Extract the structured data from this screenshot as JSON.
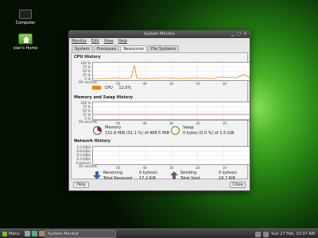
{
  "desktop": {
    "icons": [
      {
        "label": "Computer"
      },
      {
        "label": "slan's Home"
      }
    ]
  },
  "window": {
    "title": "System Monitor",
    "menu": [
      "Monitor",
      "Edit",
      "View",
      "Help"
    ],
    "tabs": [
      "System",
      "Processes",
      "Resources",
      "File Systems"
    ],
    "active_tab": "Resources",
    "cpu": {
      "heading": "CPU History",
      "ticks": [
        "100 %",
        "75 %",
        "50 %",
        "25 %",
        "0 %",
        "60 seconds",
        "50",
        "40",
        "30",
        "20",
        "10"
      ],
      "legend_label": "CPU",
      "legend_value": "11.0%",
      "color": "#e8881c"
    },
    "memory": {
      "heading": "Memory and Swap History",
      "ticks": [
        "100 %",
        "75 %",
        "50 %",
        "25 %",
        "0 %",
        "60 seconds",
        "50",
        "40",
        "30",
        "20",
        "10"
      ],
      "memory_label": "Memory",
      "memory_value": "151.8 MiB (31.1 %) of 488.5 MiB",
      "swap_label": "Swap",
      "swap_value": "0 bytes (0.0 %) of 1.5 GiB",
      "memory_color": "#8b1a5c",
      "swap_color": "#4e9a06"
    },
    "network": {
      "heading": "Network History",
      "ticks": [
        "1.0 KiB/s",
        "0.8 KiB/s",
        "0.5 KiB/s",
        "0.3 KiB/s",
        "0 bytes/s",
        "60 seconds",
        "50",
        "40",
        "30",
        "20",
        "10"
      ],
      "receiving_label": "Receiving",
      "receiving_value": "0 bytes/s",
      "total_received_label": "Total Received",
      "total_received_value": "17.2 KiB",
      "sending_label": "Sending",
      "sending_value": "0 bytes/s",
      "total_sent_label": "Total Sent",
      "total_sent_value": "19.7 KiB",
      "receiving_color": "#3465a4",
      "sending_color": "#75507b"
    },
    "buttons": {
      "help": "Help",
      "close": "Close"
    }
  },
  "taskbar": {
    "menu_label": "Menu",
    "task_label": "System Monitor",
    "clock": "Sun 27 Feb, 10:37 AM"
  }
}
